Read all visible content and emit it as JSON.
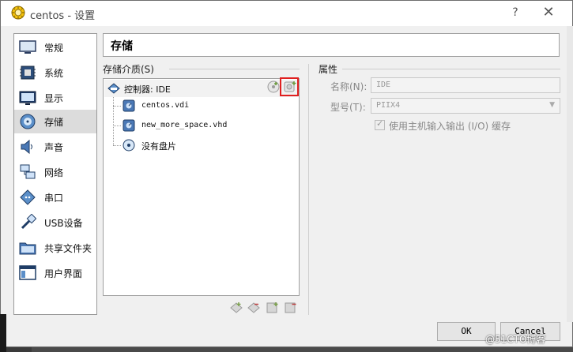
{
  "window": {
    "title": "centos - 设置",
    "help": "?",
    "close": "✕"
  },
  "sidebar": {
    "items": [
      {
        "label": "常规",
        "icon": "general-monitor-icon"
      },
      {
        "label": "系统",
        "icon": "system-chip-icon"
      },
      {
        "label": "显示",
        "icon": "display-icon"
      },
      {
        "label": "存储",
        "icon": "storage-disk-icon",
        "selected": true
      },
      {
        "label": "声音",
        "icon": "speaker-icon"
      },
      {
        "label": "网络",
        "icon": "network-icon"
      },
      {
        "label": "串口",
        "icon": "serial-port-icon"
      },
      {
        "label": "USB设备",
        "icon": "usb-icon"
      },
      {
        "label": "共享文件夹",
        "icon": "shared-folder-icon"
      },
      {
        "label": "用户界面",
        "icon": "user-interface-icon"
      }
    ]
  },
  "page": {
    "title": "存储"
  },
  "storage": {
    "section_label": "存储介质(S)",
    "controller": "控制器: IDE",
    "items": [
      {
        "name": "centos.vdi",
        "type": "hard-disk"
      },
      {
        "name": "new_more_space.vhd",
        "type": "hard-disk"
      },
      {
        "name": "没有盘片",
        "type": "optical"
      }
    ]
  },
  "attributes": {
    "section_label": "属性",
    "name_label": "名称(N):",
    "name_value": "IDE",
    "type_label": "型号(T):",
    "type_value": "PIIX4",
    "host_io_label": "使用主机输入输出 (I/O) 缓存",
    "host_io_checked": true
  },
  "buttons": {
    "ok": "OK",
    "cancel": "Cancel"
  },
  "watermark": "@51CTO博客",
  "colors": {
    "highlight": "#e02020",
    "selection": "#dcdcdc"
  }
}
